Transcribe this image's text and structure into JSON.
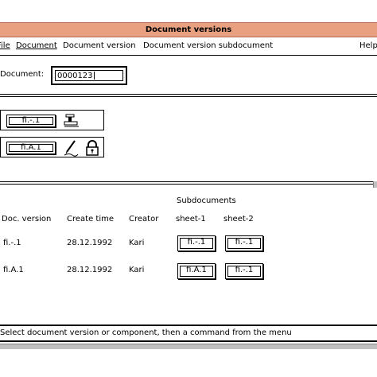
{
  "window": {
    "title": "Document versions"
  },
  "menu": {
    "items": [
      {
        "label": "File"
      },
      {
        "label": "Document"
      },
      {
        "label": "Document version"
      },
      {
        "label": "Document version subdocument"
      },
      {
        "label": "Help"
      }
    ]
  },
  "document_field": {
    "label": "Document:",
    "value": "0000123"
  },
  "version_buttons": [
    {
      "label": "fi.-.1",
      "icon": "stamp-icon"
    },
    {
      "label": "fi.A.1",
      "icon": "pen-lock-icon"
    }
  ],
  "table": {
    "group_header": "Subdocuments",
    "columns": [
      "Doc. version",
      "Create time",
      "Creator",
      "sheet-1",
      "sheet-2"
    ],
    "rows": [
      {
        "doc_version": "fi.-.1",
        "create_time": "28.12.1992",
        "creator": "Kari",
        "sheet1": "fi.-.1",
        "sheet2": "fi.-.1"
      },
      {
        "doc_version": "fi.A.1",
        "create_time": "28.12.1992",
        "creator": "Kari",
        "sheet1": "fi.A.1",
        "sheet2": "fi.-.1"
      }
    ]
  },
  "status": {
    "text": "Select document version or component, then a command from the menu"
  },
  "colors": {
    "titlebar": "#e8a080",
    "frame": "#000000",
    "background": "#ffffff"
  }
}
